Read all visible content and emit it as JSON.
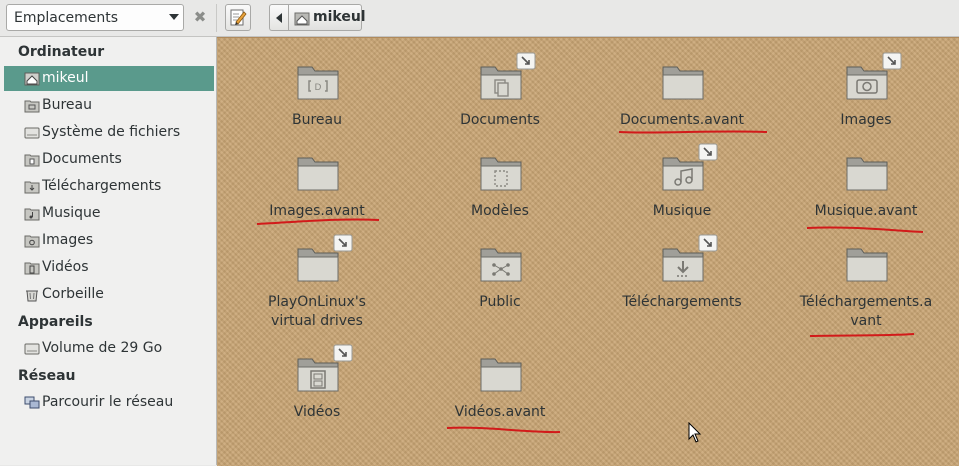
{
  "toolbar": {
    "places_combo": "Emplacements",
    "close_symbol": "✖",
    "path_segment": "mikeul"
  },
  "sidebar": {
    "sections": [
      {
        "label": "Ordinateur"
      },
      {
        "label": "Appareils"
      },
      {
        "label": "Réseau"
      }
    ],
    "items": [
      {
        "label": "mikeul",
        "icon": "home-icon"
      },
      {
        "label": "Bureau",
        "icon": "desktop-folder-icon"
      },
      {
        "label": "Système de fichiers",
        "icon": "drive-icon"
      },
      {
        "label": "Documents",
        "icon": "folder-icon"
      },
      {
        "label": "Téléchargements",
        "icon": "folder-icon"
      },
      {
        "label": "Musique",
        "icon": "folder-icon"
      },
      {
        "label": "Images",
        "icon": "folder-icon"
      },
      {
        "label": "Vidéos",
        "icon": "folder-icon"
      },
      {
        "label": "Corbeille",
        "icon": "trash-icon"
      },
      {
        "label": "Volume de 29 Go",
        "icon": "drive-icon"
      },
      {
        "label": "Parcourir le réseau",
        "icon": "network-icon"
      }
    ]
  },
  "folders": [
    {
      "name": "Bureau",
      "emblem": "desktop",
      "link": false
    },
    {
      "name": "Documents",
      "emblem": "document",
      "link": true
    },
    {
      "name": "Documents.avant",
      "emblem": "",
      "link": false
    },
    {
      "name": "Images",
      "emblem": "camera",
      "link": true
    },
    {
      "name": "Images.avant",
      "emblem": "",
      "link": false
    },
    {
      "name": "Modèles",
      "emblem": "template",
      "link": false
    },
    {
      "name": "Musique",
      "emblem": "music",
      "link": true
    },
    {
      "name": "Musique.avant",
      "emblem": "",
      "link": false
    },
    {
      "name": "PlayOnLinux's virtual drives",
      "emblem": "",
      "link": true
    },
    {
      "name": "Public",
      "emblem": "share",
      "link": false
    },
    {
      "name": "Téléchargements",
      "emblem": "download",
      "link": true
    },
    {
      "name": "Téléchargements.avant",
      "emblem": "",
      "link": false
    },
    {
      "name": "Vidéos",
      "emblem": "film",
      "link": true
    },
    {
      "name": "Vidéos.avant",
      "emblem": "",
      "link": false
    }
  ],
  "colors": {
    "selection": "#5a9a8c",
    "annotation_underline": "#d21a1a",
    "background_texture": "#c9a574"
  }
}
